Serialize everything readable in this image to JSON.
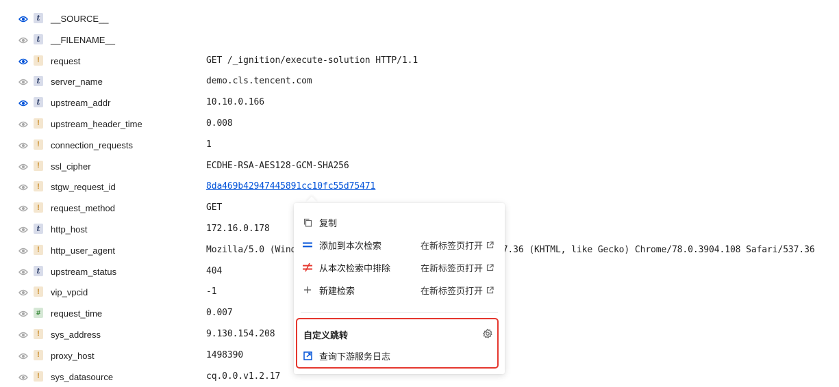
{
  "fields": [
    {
      "name": "__SOURCE__",
      "value": "",
      "type": "t",
      "visible": true
    },
    {
      "name": "__FILENAME__",
      "value": "",
      "type": "t",
      "visible": false
    },
    {
      "name": "request",
      "value": "GET /_ignition/execute-solution HTTP/1.1",
      "type": "!",
      "visible": true
    },
    {
      "name": "server_name",
      "value": "demo.cls.tencent.com",
      "type": "t",
      "visible": false
    },
    {
      "name": "upstream_addr",
      "value": "10.10.0.166",
      "type": "t",
      "visible": true
    },
    {
      "name": "upstream_header_time",
      "value": "0.008",
      "type": "!",
      "visible": false
    },
    {
      "name": "connection_requests",
      "value": "1",
      "type": "!",
      "visible": false
    },
    {
      "name": "ssl_cipher",
      "value": "ECDHE-RSA-AES128-GCM-SHA256",
      "type": "!",
      "visible": false
    },
    {
      "name": "stgw_request_id",
      "value": "8da469b42947445891cc10fc55d75471",
      "type": "!",
      "visible": false,
      "link": true
    },
    {
      "name": "request_method",
      "value": "GET",
      "type": "!",
      "visible": false
    },
    {
      "name": "http_host",
      "value": "172.16.0.178",
      "type": "t",
      "visible": false
    },
    {
      "name": "http_user_agent",
      "value": "Mozilla/5.0 (Windows NT 10.0; Win64; x64) AppleWebKit/537.36 (KHTML, like Gecko) Chrome/78.0.3904.108 Safari/537.36",
      "type": "!",
      "visible": false
    },
    {
      "name": "upstream_status",
      "value": "404",
      "type": "t",
      "visible": false
    },
    {
      "name": "vip_vpcid",
      "value": "-1",
      "type": "!",
      "visible": false
    },
    {
      "name": "request_time",
      "value": "0.007",
      "type": "#",
      "visible": false
    },
    {
      "name": "sys_address",
      "value": "9.130.154.208",
      "type": "!",
      "visible": false
    },
    {
      "name": "proxy_host",
      "value": "1498390",
      "type": "!",
      "visible": false
    },
    {
      "name": "sys_datasource",
      "value": "cq.0.0.v1.2.17",
      "type": "!",
      "visible": false
    }
  ],
  "menu": {
    "copy": "复制",
    "add_to_search": "添加到本次检索",
    "exclude_from_search": "从本次检索中排除",
    "new_search": "新建检索",
    "open_new_tab": "在新标签页打开",
    "custom_jump_title": "自定义跳转",
    "custom_jump_link": "查询下游服务日志"
  },
  "colors": {
    "eye_visible": "#0052d9",
    "eye_hidden": "#aaaaaa",
    "link": "#0052d9",
    "highlight_border": "#e5372e"
  }
}
